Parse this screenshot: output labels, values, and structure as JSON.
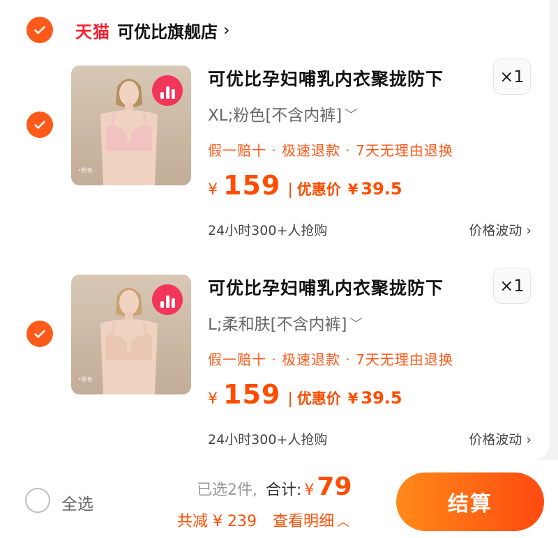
{
  "store": {
    "brand": "天猫",
    "name": "可优比旗舰店",
    "chevron": "›",
    "selected": true,
    "check_icon": "check-icon"
  },
  "items": [
    {
      "selected": true,
      "title": "可优比孕妇哺乳内衣聚拢防下",
      "quantity": "×1",
      "sku": "XL;粉色[不含内裤]",
      "promo": "假一赔十 · 极速退款 · 7天无理由退换",
      "price_symbol": "¥",
      "price": "159",
      "discount_label": "优惠价",
      "discount_symbol": "¥",
      "discount_price": "39.5",
      "sales": "24小时300+人抢购",
      "trend": "价格波动",
      "image_caption": "•粉色",
      "bra_color": "#f1c3c0"
    },
    {
      "selected": true,
      "title": "可优比孕妇哺乳内衣聚拢防下",
      "quantity": "×1",
      "sku": "L;柔和肤[不含内裤]",
      "promo": "假一赔十 · 极速退款 · 7天无理由退换",
      "price_symbol": "¥",
      "price": "159",
      "discount_label": "优惠价",
      "discount_symbol": "¥",
      "discount_price": "39.5",
      "sales": "24小时300+人抢购",
      "trend": "价格波动",
      "image_caption": "•肤色",
      "bra_color": "#e9c7b2"
    }
  ],
  "footer": {
    "select_all": "全选",
    "selected_count": "已选2件,",
    "total_label": "合计:",
    "total_symbol": "¥",
    "total_amount": "79",
    "savings": "共减 ¥ 239",
    "detail": "查看明细",
    "checkout": "结算"
  },
  "colors": {
    "accent": "#ff5a1a",
    "price": "#ff4d00",
    "tmall": "#ff1d2b"
  }
}
